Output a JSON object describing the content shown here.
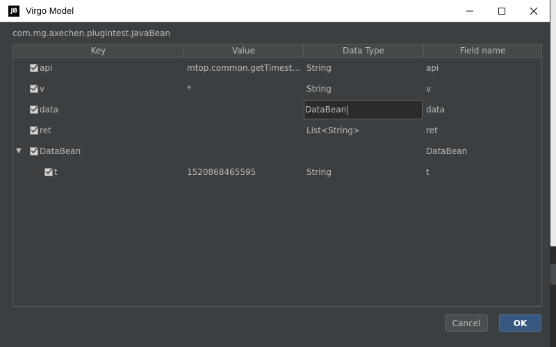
{
  "window": {
    "app_icon_text": "JB",
    "title": "Virgo Model",
    "minimize_glyph": "—",
    "maximize_glyph": "☐",
    "close_glyph": "✕"
  },
  "class_path": "com.mg.axechen.plugintest.JavaBean",
  "table": {
    "headers": [
      "Key",
      "Value",
      "Data Type",
      "Field name"
    ],
    "rows": [
      {
        "key": "api",
        "value": "mtop.common.getTimesta...",
        "type": "String",
        "field": "api",
        "checked": true
      },
      {
        "key": "v",
        "value": "*",
        "type": "String",
        "field": "v",
        "checked": true
      },
      {
        "key": "data",
        "value": "",
        "type": "DataBean",
        "field": "data",
        "checked": true,
        "editing": true
      },
      {
        "key": "ret",
        "value": "",
        "type": "List<String>",
        "field": "ret",
        "checked": true
      },
      {
        "key": "DataBean",
        "value": "",
        "type": "",
        "field": "DataBean",
        "checked": true,
        "expanded": true
      },
      {
        "key": "t",
        "value": "1520868465595",
        "type": "String",
        "field": "t",
        "checked": true,
        "child": true
      }
    ],
    "expander_glyph": "▼"
  },
  "buttons": {
    "cancel": "Cancel",
    "ok": "OK"
  },
  "colors": {
    "dialog_bg": "#3c3f41",
    "text": "#bbbbbb",
    "ok_button": "#365880"
  }
}
